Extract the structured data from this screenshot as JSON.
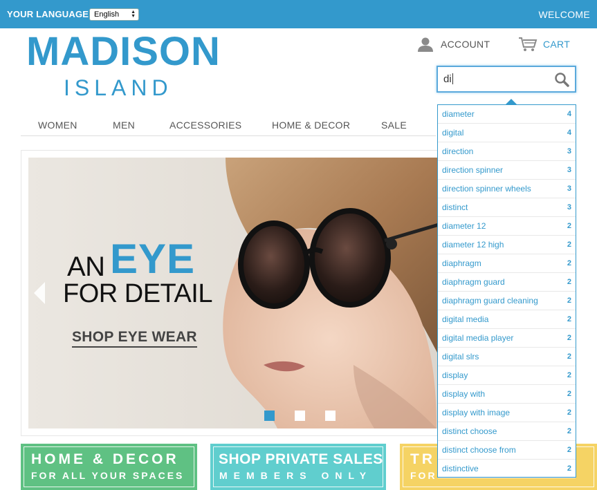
{
  "topbar": {
    "language_label": "YOUR LANGUAGE:",
    "language_selected": "English",
    "welcome": "WELCOME"
  },
  "logo": {
    "main": "MADISON",
    "sub": "ISLAND"
  },
  "header": {
    "account": "ACCOUNT",
    "cart": "CART"
  },
  "search": {
    "value": "di"
  },
  "nav": {
    "items": [
      "WOMEN",
      "MEN",
      "ACCESSORIES",
      "HOME & DECOR",
      "SALE"
    ]
  },
  "hero": {
    "line1_a": "AN",
    "line1_b": "EYE",
    "line2": "FOR DETAIL",
    "cta": "SHOP EYE WEAR"
  },
  "tiles": [
    {
      "title": "HOME & DECOR",
      "sub": "FOR ALL YOUR SPACES"
    },
    {
      "title": "SHOP PRIVATE SALES",
      "sub": "MEMBERS ONLY"
    },
    {
      "title": "TR",
      "sub": "FOR"
    }
  ],
  "autocomplete": [
    {
      "term": "diameter",
      "count": "4"
    },
    {
      "term": "digital",
      "count": "4"
    },
    {
      "term": "direction",
      "count": "3"
    },
    {
      "term": "direction spinner",
      "count": "3"
    },
    {
      "term": "direction spinner wheels",
      "count": "3"
    },
    {
      "term": "distinct",
      "count": "3"
    },
    {
      "term": "diameter 12",
      "count": "2"
    },
    {
      "term": "diameter 12 high",
      "count": "2"
    },
    {
      "term": "diaphragm",
      "count": "2"
    },
    {
      "term": "diaphragm guard",
      "count": "2"
    },
    {
      "term": "diaphragm guard cleaning",
      "count": "2"
    },
    {
      "term": "digital media",
      "count": "2"
    },
    {
      "term": "digital media player",
      "count": "2"
    },
    {
      "term": "digital slrs",
      "count": "2"
    },
    {
      "term": "display",
      "count": "2"
    },
    {
      "term": "display with",
      "count": "2"
    },
    {
      "term": "display with image",
      "count": "2"
    },
    {
      "term": "distinct choose",
      "count": "2"
    },
    {
      "term": "distinct choose from",
      "count": "2"
    },
    {
      "term": "distinctive",
      "count": "2"
    }
  ],
  "colors": {
    "brand": "#3399cc",
    "green": "#5fc183",
    "teal": "#60cece",
    "yellow": "#f5d364"
  },
  "icons": [
    "account-icon",
    "cart-icon",
    "search-icon",
    "slider-prev-icon"
  ]
}
